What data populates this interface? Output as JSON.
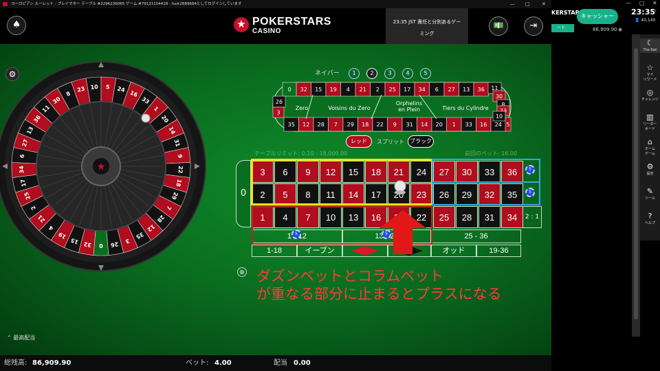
{
  "window": {
    "title": "ヨーロピアン ルーレット - プレイマネー テーブル #2296236065 ゲーム #7912115441​8 - fuck2889684としてログインしています",
    "controls": [
      "—",
      "□",
      "✕"
    ]
  },
  "header": {
    "logo_line1": "POKERSTARS",
    "logo_line2": "CASINO",
    "news_line1": "23:35 JST 責任と分別あるゲー",
    "news_line2": "ミング"
  },
  "neighbors": {
    "label": "ネイバー",
    "options": [
      "1",
      "2",
      "3",
      "4",
      "5"
    ],
    "selected": "2"
  },
  "racetrack": {
    "top": [
      "32",
      "15",
      "19",
      "4",
      "21",
      "2",
      "25",
      "17",
      "34",
      "6",
      "27",
      "13",
      "36"
    ],
    "bottom": [
      "35",
      "12",
      "28",
      "7",
      "29",
      "18",
      "22",
      "9",
      "31",
      "14",
      "20",
      "1",
      "33",
      "16",
      "24"
    ],
    "left": [
      "0",
      "26",
      "3"
    ],
    "right": [
      "11",
      "30",
      "8",
      "23",
      "10",
      "5"
    ],
    "sections": [
      "Zero",
      "Voisins du Zero",
      "Orphelins\nen Plein",
      "Tiers du Cylindre"
    ]
  },
  "bet_mode": {
    "red": "レッド",
    "split": "スプリット",
    "black": "ブラック"
  },
  "limits": {
    "table": "テーブルリミット: 0.10 - 18,000.00",
    "prev": "前回のベット: 16.00"
  },
  "grid": {
    "zero": "0",
    "rows": [
      [
        [
          "3",
          "r"
        ],
        [
          "6",
          "k"
        ],
        [
          "9",
          "r"
        ],
        [
          "12",
          "r"
        ],
        [
          "15",
          "k"
        ],
        [
          "18",
          "r"
        ],
        [
          "21",
          "r"
        ],
        [
          "24",
          "k"
        ],
        [
          "27",
          "r"
        ],
        [
          "30",
          "r"
        ],
        [
          "33",
          "k"
        ],
        [
          "36",
          "r"
        ]
      ],
      [
        [
          "2",
          "k"
        ],
        [
          "5",
          "r"
        ],
        [
          "8",
          "k"
        ],
        [
          "11",
          "k"
        ],
        [
          "14",
          "r"
        ],
        [
          "17",
          "k"
        ],
        [
          "20",
          "k"
        ],
        [
          "23",
          "r"
        ],
        [
          "26",
          "k"
        ],
        [
          "29",
          "k"
        ],
        [
          "32",
          "r"
        ],
        [
          "35",
          "k"
        ]
      ],
      [
        [
          "1",
          "r"
        ],
        [
          "4",
          "k"
        ],
        [
          "7",
          "r"
        ],
        [
          "10",
          "k"
        ],
        [
          "13",
          "k"
        ],
        [
          "16",
          "r"
        ],
        [
          "19",
          "r"
        ],
        [
          "22",
          "k"
        ],
        [
          "25",
          "r"
        ],
        [
          "28",
          "k"
        ],
        [
          "31",
          "k"
        ],
        [
          "34",
          "r"
        ]
      ]
    ],
    "column_label": "2 : 1",
    "dozens": [
      "1 - 12",
      "13 - 24",
      "25 - 36"
    ],
    "outside": [
      "1-18",
      "イーブン",
      "",
      "",
      "オッド",
      "19-36"
    ]
  },
  "chips": {
    "value": "5"
  },
  "annotation": {
    "line1": "ダズンベットとコラムベット",
    "line2": "が重なる部分に止まるとプラスになる"
  },
  "max_payout": "最高配当",
  "status": {
    "balance_label": "総残高:",
    "balance": "86,909.90",
    "bet_label": "ベット:",
    "bet": "4.00",
    "payout_label": "配当",
    "payout": "0.00"
  },
  "right_panel": {
    "brand": "KERSTARS",
    "cashier": "キャッシャー",
    "green_tab": "ート",
    "balance": "86,909.90",
    "time": "23:35",
    "tz": "JST",
    "count": "40,140",
    "nav": [
      {
        "icon": "rail-icon",
        "glyph": "☾",
        "label": "The Rail"
      },
      {
        "icon": "star-icon",
        "glyph": "☆",
        "label": "マイ\nリワード"
      },
      {
        "icon": "challenge-icon",
        "glyph": "◎",
        "label": "チャレンジ"
      },
      {
        "icon": "leaderboard-icon",
        "glyph": "▥",
        "label": "リーダー\nボード"
      },
      {
        "icon": "home-icon",
        "glyph": "⌂",
        "label": "ホーム\nゲーム"
      },
      {
        "icon": "settings-icon",
        "glyph": "⚙",
        "label": "設定"
      },
      {
        "icon": "tools-icon",
        "glyph": "✎",
        "label": "ツール"
      },
      {
        "icon": "help-icon",
        "glyph": "?",
        "label": "ヘルプ"
      }
    ]
  },
  "wheel": {
    "numbers": [
      "0",
      "32",
      "15",
      "19",
      "4",
      "21",
      "2",
      "25",
      "17",
      "34",
      "6",
      "27",
      "13",
      "36",
      "11",
      "30",
      "8",
      "23",
      "10",
      "5",
      "24",
      "16",
      "33",
      "1",
      "20",
      "14",
      "31",
      "9",
      "22",
      "18",
      "29",
      "7",
      "28",
      "12",
      "35",
      "3",
      "26"
    ]
  },
  "colors": {
    "red": "#b00d1e",
    "black": "#111111",
    "green": "#0a6e20",
    "highlight_yellow": "#f5e211",
    "highlight_blue": "#36a6e0",
    "annotation": "#ff3b3b"
  }
}
